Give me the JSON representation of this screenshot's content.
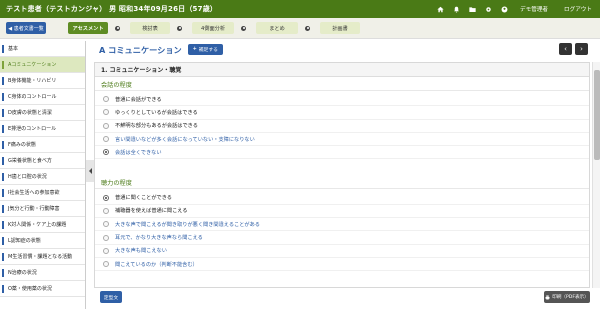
{
  "header": {
    "title": "テスト患者（テストカンジャ） 男 昭和34年09月26日（57歳）",
    "icons": [
      "home-icon",
      "bell-icon",
      "folder-icon",
      "gear-icon",
      "user-icon"
    ],
    "user_label": "デモ管理者",
    "logout_label": "ログアウト"
  },
  "stepbar": {
    "back_label": "◀ 患者文書一覧",
    "steps": [
      {
        "label": "アセスメント",
        "active": true
      },
      {
        "label": "検討表",
        "active": false
      },
      {
        "label": "4側面分析",
        "active": false
      },
      {
        "label": "まとめ",
        "active": false
      },
      {
        "label": "計画書",
        "active": false
      }
    ]
  },
  "sidebar": {
    "items": [
      {
        "label": "基本"
      },
      {
        "label": "Aコミュニケーション",
        "active": true
      },
      {
        "label": "B身体機能・リハビリ"
      },
      {
        "label": "C身体のコントロール"
      },
      {
        "label": "D皮膚の状態と清潔"
      },
      {
        "label": "E排泄のコントロール"
      },
      {
        "label": "F痛みの状態"
      },
      {
        "label": "G栄養状態と食べ方"
      },
      {
        "label": "H歯と口腔の状況"
      },
      {
        "label": "I社会生活への参加意欲"
      },
      {
        "label": "J気分と行動・行動障害"
      },
      {
        "label": "K対人関係・ケア上の課題"
      },
      {
        "label": "L認知症の状態"
      },
      {
        "label": "M生活習慣・課題となる活動"
      },
      {
        "label": "N治療の状況"
      },
      {
        "label": "O薬・使用薬の状況"
      }
    ]
  },
  "main": {
    "section_title": "A コミュニケーション",
    "help_label": "補足する",
    "prev_icon": "chevron-left-icon",
    "next_icon": "chevron-right-icon",
    "panel_title": "1. コミュニケーション・聴覚",
    "groups": [
      {
        "title": "会話の程度",
        "options": [
          {
            "label": "普通に会話ができる",
            "checked": false,
            "color": "dark"
          },
          {
            "label": "ゆっくりとしているが会話はできる",
            "checked": false,
            "color": "dark"
          },
          {
            "label": "不鮮明な部分もあるが会話はできる",
            "checked": false,
            "color": "dark"
          },
          {
            "label": "言い間違いなどが多く会話になっていない・支障になりない",
            "checked": false,
            "color": "blue"
          },
          {
            "label": "会話は全くできない",
            "checked": true,
            "color": "blue"
          }
        ]
      },
      {
        "title": "聴力の程度",
        "options": [
          {
            "label": "普通に聞くことができる",
            "checked": true,
            "color": "dark"
          },
          {
            "label": "補聴器を使えば普通に聞こえる",
            "checked": false,
            "color": "dark"
          },
          {
            "label": "大きな声で聞こえるが聞き取りが悪く聞き間違えることがある",
            "checked": false,
            "color": "blue"
          },
          {
            "label": "耳元で、かなり大きな声なら聞こえる",
            "checked": false,
            "color": "blue"
          },
          {
            "label": "大きな声も聞こえない",
            "checked": false,
            "color": "blue"
          },
          {
            "label": "聞こえているのか（判断不能含む）",
            "checked": false,
            "color": "blue"
          }
        ]
      }
    ],
    "save_label": "定型文",
    "pdf_label": "印刷（PDF表示）"
  }
}
